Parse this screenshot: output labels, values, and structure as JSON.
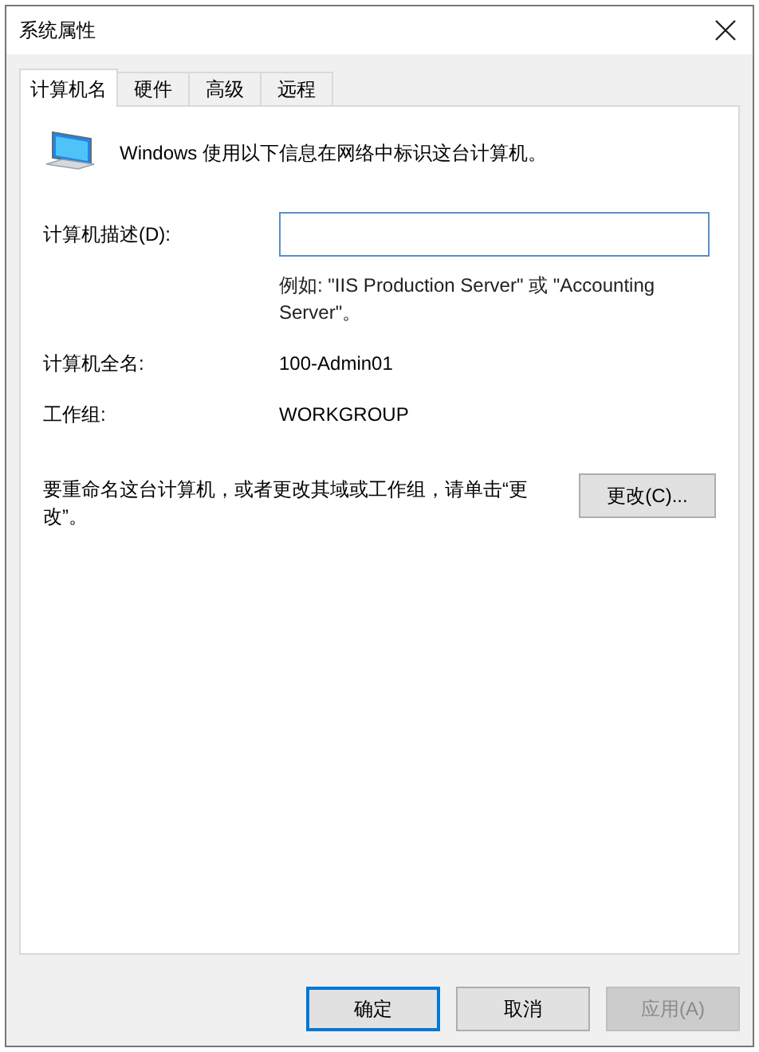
{
  "window": {
    "title": "系统属性"
  },
  "tabs": [
    {
      "label": "计算机名",
      "selected": true
    },
    {
      "label": "硬件",
      "selected": false
    },
    {
      "label": "高级",
      "selected": false
    },
    {
      "label": "远程",
      "selected": false
    }
  ],
  "panel": {
    "intro": "Windows 使用以下信息在网络中标识这台计算机。",
    "description": {
      "label": "计算机描述(D):",
      "focused": true,
      "hint": "例如: \"IIS Production Server\" 或 \"Accounting Server\"。"
    },
    "info": [
      {
        "label": "计算机全名:",
        "value": "100-Admin01"
      },
      {
        "label": "工作组:",
        "value": "WORKGROUP"
      }
    ],
    "rename": {
      "text": "要重命名这台计算机，或者更改其域或工作组，请单击“更改”。",
      "button": "更改(C)..."
    }
  },
  "buttons": [
    {
      "label": "确定",
      "default": true,
      "disabled": false
    },
    {
      "label": "取消",
      "default": false,
      "disabled": false
    },
    {
      "label": "应用(A)",
      "default": false,
      "disabled": true
    }
  ]
}
